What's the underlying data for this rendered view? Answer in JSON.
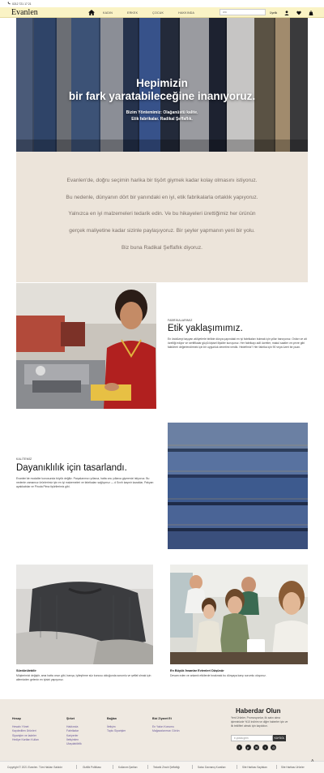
{
  "topbar": {
    "phone": "0212 721 17 21"
  },
  "header": {
    "logo": "Evanlen",
    "nav": [
      "KADIN",
      "ERKEK",
      "ÇOCUK",
      "HAKKINDA"
    ],
    "search_placeholder": "ara",
    "account_label": "Üyelik"
  },
  "hero": {
    "title_line1": "Hepimizin",
    "title_line2": "bir fark yaratabileceğine inanıyoruz.",
    "sub_line1": "Bizim Yöntemimiz: Olağanüstü kalite.",
    "sub_line2": "Etik fabrikalar. Radikal Şeffaflık."
  },
  "intro": {
    "lines": [
      "Evanlen'de, doğru seçimin harika bir tişört giymek kadar kolay olmasını istiyoruz.",
      "Bu nedenle, dünyanın dört bir yanındaki en iyi, etik fabrikalarla ortaklık yapıyoruz.",
      "Yalnızca en iyi malzemeleri tedarik edin. Ve bu hikayeleri ürettiğimiz her ürünün",
      "gerçek maliyetine kadar sizinle paylaşıyoruz. Bir şeyler yapmanın yeni bir yolu.",
      "Biz buna Radikal Şeffaflık diyoruz."
    ]
  },
  "section_ethics": {
    "eyebrow": "FABRİKALARIMIZ",
    "title": "Etik yaklaşımımız.",
    "body": "En üstdüzeyi taşıyan atölyelerle birlikte dünya çapındaki en iyi fabrikaları bulmak için yıllar harcıyoruz. Onları ve ait özelliği ediyor ve sertifikalar güçlü kişisel ilişkiler kuruyoruz. Her fabrikayı adil ücretler, makul saatler ve çevre gibi faktörleri değerlendirmek için bir uygunluk denetimi verdik. Hedefimiz? Her fabrika için 90 veya üzeri bir puan."
  },
  "section_quality": {
    "eyebrow": "KALİTEMİZ",
    "title": "Dayanıklılık için tasarlandı.",
    "body": "Evanlen'de modaller konusunda büyük değiliz. Parçalarımızı yıllarca, hatta onu yıllarca giymenizi istiyoruz. Bu nedenle zamansız ürünlerimiz için en iyi malzemeleri ve fabrikaları sağlıyoruz — d Sınıfı kaşmir kazaklar, Pakyan ayakkabılar ve Piruda Pima tişörtlerimiz gibi."
  },
  "card_sustain": {
    "title": "Sürdürülebilir",
    "body": "Müşterimizi değiştir, ama hatta onun gibi, barışa, iyileştirme süz konusu olduğunda sorumlu ve şeffaf olmak için ailemizden gelenin en iyisini yapıyoruz."
  },
  "card_people": {
    "title": "En Büyük İnsanlar Evlenleri Düşünür",
    "body": "Devam eden ve anlamlı etkilerde bırakmak bu dünyaya karşı sorumlu oluyoruz."
  },
  "footer": {
    "col1": {
      "heading": "Hesap",
      "links": [
        "Hesabı Yönet",
        "Kaydedilen Ürünleri",
        "Siparişler ve İadeler",
        "Hediye Kartları Kullan"
      ]
    },
    "col2": {
      "heading": "Şirket",
      "links": [
        "Hakkında",
        "Fabrikalar",
        "Kariyerler",
        "İletişimlen",
        "Ulaşılabilirlik"
      ]
    },
    "col3": {
      "heading": "Bağlan",
      "links": [
        "İletişim",
        "Toplu Siparişler"
      ]
    },
    "col4": {
      "heading": "Bizi Ziyaret Et",
      "links": [
        "En Yakın Konumu",
        "Mağazalarımızı Görün"
      ]
    },
    "newsletter": {
      "title": "Haberdar Olun",
      "text": "Yeni Ürünler, Promosyonlar, ilk satın alma işleminizde %10 indirim ve diğer haberler için ve ilk teklifleri almak için kaydolun.",
      "placeholder": "e-posta girin",
      "button": "KAYDOL"
    }
  },
  "bottombar": {
    "copyright": "Copyright © 2021 Evanlen. Tüm Hakları Saklıdır",
    "links": [
      "Gizlilik Politikası",
      "Kullanım Şartları",
      "Tedarik Zinciri Şeffaflığı",
      "Satıcı Davranış Kuralları",
      "Site Haritası Sayfaları",
      "Site Haritası Ürünler"
    ]
  }
}
